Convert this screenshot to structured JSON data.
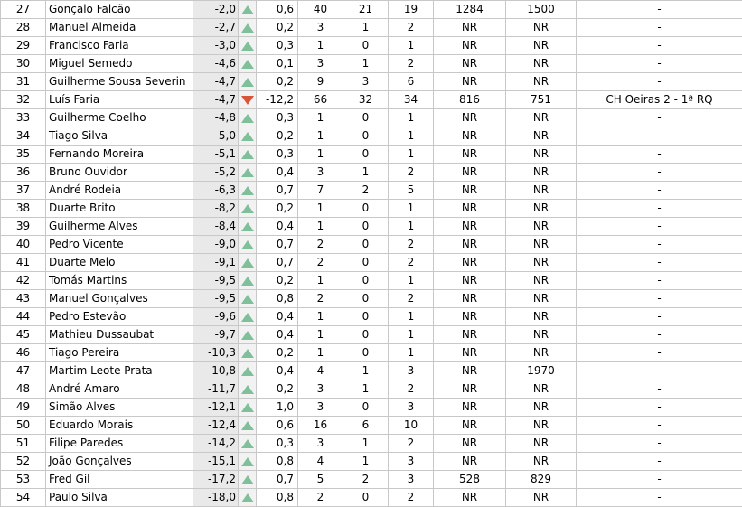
{
  "colors": {
    "trend_up": "#7fbf9a",
    "trend_down": "#d9553a",
    "score_bg": "#e9e9e9"
  },
  "rows": [
    {
      "rank": "27",
      "name": "Gonçalo Falcão",
      "score": "-2,0",
      "trend": "up",
      "change": "0,6",
      "c1": "40",
      "c2": "21",
      "c3": "19",
      "c4": "1284",
      "c5": "1500",
      "note": "-"
    },
    {
      "rank": "28",
      "name": "Manuel Almeida",
      "score": "-2,7",
      "trend": "up",
      "change": "0,2",
      "c1": "3",
      "c2": "1",
      "c3": "2",
      "c4": "NR",
      "c5": "NR",
      "note": "-"
    },
    {
      "rank": "29",
      "name": "Francisco Faria",
      "score": "-3,0",
      "trend": "up",
      "change": "0,3",
      "c1": "1",
      "c2": "0",
      "c3": "1",
      "c4": "NR",
      "c5": "NR",
      "note": "-"
    },
    {
      "rank": "30",
      "name": "Miguel Semedo",
      "score": "-4,6",
      "trend": "up",
      "change": "0,1",
      "c1": "3",
      "c2": "1",
      "c3": "2",
      "c4": "NR",
      "c5": "NR",
      "note": "-"
    },
    {
      "rank": "31",
      "name": "Guilherme Sousa Severin",
      "score": "-4,7",
      "trend": "up",
      "change": "0,2",
      "c1": "9",
      "c2": "3",
      "c3": "6",
      "c4": "NR",
      "c5": "NR",
      "note": "-"
    },
    {
      "rank": "32",
      "name": "Luís Faria",
      "score": "-4,7",
      "trend": "down",
      "change": "-12,2",
      "c1": "66",
      "c2": "32",
      "c3": "34",
      "c4": "816",
      "c5": "751",
      "note": "CH Oeiras 2 - 1ª RQ"
    },
    {
      "rank": "33",
      "name": "Guilherme Coelho",
      "score": "-4,8",
      "trend": "up",
      "change": "0,3",
      "c1": "1",
      "c2": "0",
      "c3": "1",
      "c4": "NR",
      "c5": "NR",
      "note": "-"
    },
    {
      "rank": "34",
      "name": "Tiago Silva",
      "score": "-5,0",
      "trend": "up",
      "change": "0,2",
      "c1": "1",
      "c2": "0",
      "c3": "1",
      "c4": "NR",
      "c5": "NR",
      "note": "-"
    },
    {
      "rank": "35",
      "name": "Fernando Moreira",
      "score": "-5,1",
      "trend": "up",
      "change": "0,3",
      "c1": "1",
      "c2": "0",
      "c3": "1",
      "c4": "NR",
      "c5": "NR",
      "note": "-"
    },
    {
      "rank": "36",
      "name": "Bruno Ouvidor",
      "score": "-5,2",
      "trend": "up",
      "change": "0,4",
      "c1": "3",
      "c2": "1",
      "c3": "2",
      "c4": "NR",
      "c5": "NR",
      "note": "-"
    },
    {
      "rank": "37",
      "name": "André Rodeia",
      "score": "-6,3",
      "trend": "up",
      "change": "0,7",
      "c1": "7",
      "c2": "2",
      "c3": "5",
      "c4": "NR",
      "c5": "NR",
      "note": "-"
    },
    {
      "rank": "38",
      "name": "Duarte Brito",
      "score": "-8,2",
      "trend": "up",
      "change": "0,2",
      "c1": "1",
      "c2": "0",
      "c3": "1",
      "c4": "NR",
      "c5": "NR",
      "note": "-"
    },
    {
      "rank": "39",
      "name": "Guilherme Alves",
      "score": "-8,4",
      "trend": "up",
      "change": "0,4",
      "c1": "1",
      "c2": "0",
      "c3": "1",
      "c4": "NR",
      "c5": "NR",
      "note": "-"
    },
    {
      "rank": "40",
      "name": "Pedro Vicente",
      "score": "-9,0",
      "trend": "up",
      "change": "0,7",
      "c1": "2",
      "c2": "0",
      "c3": "2",
      "c4": "NR",
      "c5": "NR",
      "note": "-"
    },
    {
      "rank": "41",
      "name": "Duarte Melo",
      "score": "-9,1",
      "trend": "up",
      "change": "0,7",
      "c1": "2",
      "c2": "0",
      "c3": "2",
      "c4": "NR",
      "c5": "NR",
      "note": "-"
    },
    {
      "rank": "42",
      "name": "Tomás Martins",
      "score": "-9,5",
      "trend": "up",
      "change": "0,2",
      "c1": "1",
      "c2": "0",
      "c3": "1",
      "c4": "NR",
      "c5": "NR",
      "note": "-"
    },
    {
      "rank": "43",
      "name": "Manuel Gonçalves",
      "score": "-9,5",
      "trend": "up",
      "change": "0,8",
      "c1": "2",
      "c2": "0",
      "c3": "2",
      "c4": "NR",
      "c5": "NR",
      "note": "-"
    },
    {
      "rank": "44",
      "name": "Pedro Estevão",
      "score": "-9,6",
      "trend": "up",
      "change": "0,4",
      "c1": "1",
      "c2": "0",
      "c3": "1",
      "c4": "NR",
      "c5": "NR",
      "note": "-"
    },
    {
      "rank": "45",
      "name": "Mathieu Dussaubat",
      "score": "-9,7",
      "trend": "up",
      "change": "0,4",
      "c1": "1",
      "c2": "0",
      "c3": "1",
      "c4": "NR",
      "c5": "NR",
      "note": "-"
    },
    {
      "rank": "46",
      "name": "Tiago Pereira",
      "score": "-10,3",
      "trend": "up",
      "change": "0,2",
      "c1": "1",
      "c2": "0",
      "c3": "1",
      "c4": "NR",
      "c5": "NR",
      "note": "-"
    },
    {
      "rank": "47",
      "name": "Martim Leote Prata",
      "score": "-10,8",
      "trend": "up",
      "change": "0,4",
      "c1": "4",
      "c2": "1",
      "c3": "3",
      "c4": "NR",
      "c5": "1970",
      "note": "-"
    },
    {
      "rank": "48",
      "name": "André Amaro",
      "score": "-11,7",
      "trend": "up",
      "change": "0,2",
      "c1": "3",
      "c2": "1",
      "c3": "2",
      "c4": "NR",
      "c5": "NR",
      "note": "-"
    },
    {
      "rank": "49",
      "name": "Simão Alves",
      "score": "-12,1",
      "trend": "up",
      "change": "1,0",
      "c1": "3",
      "c2": "0",
      "c3": "3",
      "c4": "NR",
      "c5": "NR",
      "note": "-"
    },
    {
      "rank": "50",
      "name": "Eduardo Morais",
      "score": "-12,4",
      "trend": "up",
      "change": "0,6",
      "c1": "16",
      "c2": "6",
      "c3": "10",
      "c4": "NR",
      "c5": "NR",
      "note": "-"
    },
    {
      "rank": "51",
      "name": "Filipe Paredes",
      "score": "-14,2",
      "trend": "up",
      "change": "0,3",
      "c1": "3",
      "c2": "1",
      "c3": "2",
      "c4": "NR",
      "c5": "NR",
      "note": "-"
    },
    {
      "rank": "52",
      "name": "João Gonçalves",
      "score": "-15,1",
      "trend": "up",
      "change": "0,8",
      "c1": "4",
      "c2": "1",
      "c3": "3",
      "c4": "NR",
      "c5": "NR",
      "note": "-"
    },
    {
      "rank": "53",
      "name": "Fred Gil",
      "score": "-17,2",
      "trend": "up",
      "change": "0,7",
      "c1": "5",
      "c2": "2",
      "c3": "3",
      "c4": "528",
      "c5": "829",
      "note": "-"
    },
    {
      "rank": "54",
      "name": "Paulo Silva",
      "score": "-18,0",
      "trend": "up",
      "change": "0,8",
      "c1": "2",
      "c2": "0",
      "c3": "2",
      "c4": "NR",
      "c5": "NR",
      "note": "-"
    }
  ]
}
